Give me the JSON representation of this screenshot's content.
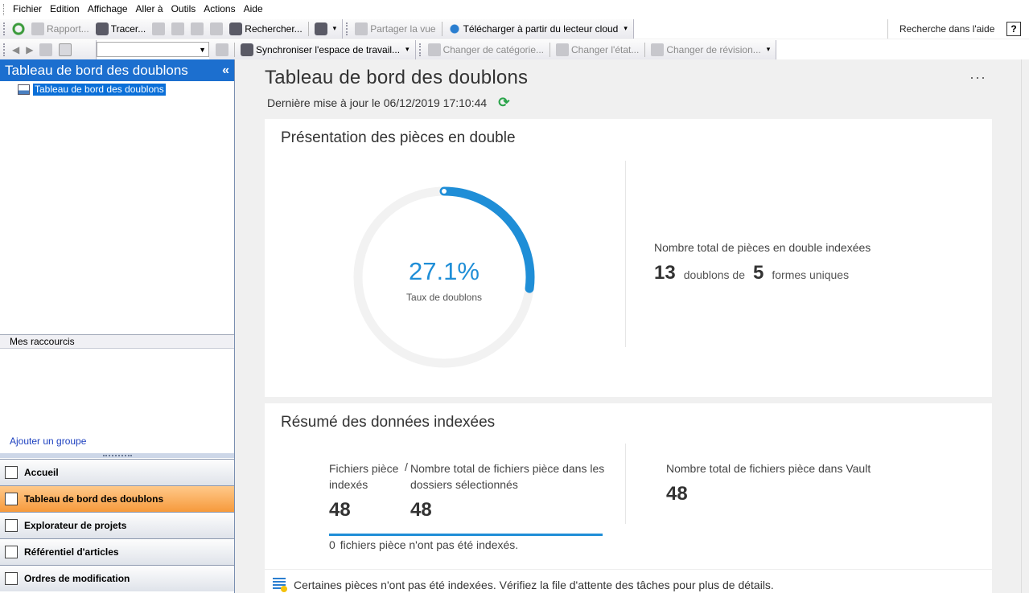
{
  "menu": [
    "Fichier",
    "Edition",
    "Affichage",
    "Aller à",
    "Outils",
    "Actions",
    "Aide"
  ],
  "toolbar1": {
    "rapport": "Rapport...",
    "tracer": "Tracer...",
    "rechercher": "Rechercher...",
    "partager": "Partager la vue",
    "telecharger": "Télécharger à partir du lecteur cloud"
  },
  "toolbar2": {
    "sync": "Synchroniser l'espace de travail...",
    "cat": "Changer de catégorie...",
    "etat": "Changer l'état...",
    "revision": "Changer de révision..."
  },
  "help_search": {
    "placeholder": "Recherche dans l'aide",
    "button": "?"
  },
  "left": {
    "title": "Tableau de bord des doublons",
    "collapse": "«",
    "tree_item": "Tableau de bord des doublons",
    "shortcuts": "Mes raccourcis",
    "add_group": "Ajouter un groupe",
    "nav": [
      "Accueil",
      "Tableau de bord des doublons",
      "Explorateur de projets",
      "Référentiel d'articles",
      "Ordres de modification"
    ]
  },
  "main": {
    "title": "Tableau de bord des doublons",
    "last_update": "Dernière mise à jour le 06/12/2019 17:10:44",
    "more": "···",
    "overview": {
      "title": "Présentation des pièces en double",
      "rate": 27.1,
      "rate_text": "27.1%",
      "rate_label": "Taux de doublons",
      "total_label": "Nombre total de pièces en double indexées",
      "duplicates": "13",
      "duplicates_text": "doublons de",
      "unique": "5",
      "unique_text": "formes uniques"
    },
    "summary": {
      "title": "Résumé des données indexées",
      "indexed_label": "Fichiers pièce indexés",
      "slash": "/",
      "indexed_value": "48",
      "selected_label": "Nombre total de fichiers pièce dans les dossiers sélectionnés",
      "selected_value": "48",
      "vault_label": "Nombre total de fichiers pièce dans Vault",
      "vault_value": "48",
      "progress": 1.0,
      "not_indexed_count": "0",
      "not_indexed_text": "fichiers pièce n'ont pas été indexés."
    },
    "notice": "Certaines pièces n'ont pas été indexées. Vérifiez la file d'attente des tâches pour plus de détails."
  },
  "colors": {
    "accent": "#1f8ed7",
    "header": "#1c6fcf",
    "active_nav": "#f69a3c"
  }
}
